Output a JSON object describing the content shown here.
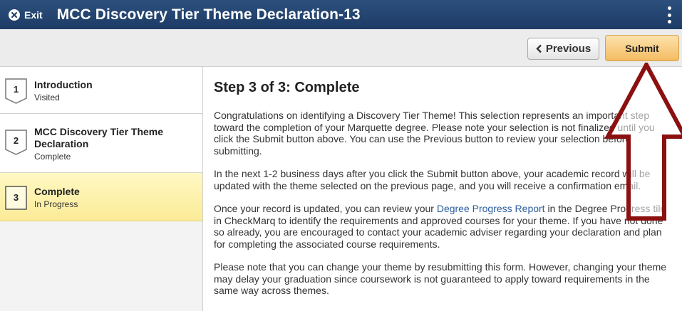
{
  "header": {
    "exit_label": "Exit",
    "title": "MCC Discovery Tier Theme Declaration-13"
  },
  "toolbar": {
    "previous_label": "Previous",
    "submit_label": "Submit"
  },
  "steps": [
    {
      "number": "1",
      "name": "Introduction",
      "status": "Visited"
    },
    {
      "number": "2",
      "name": "MCC Discovery Tier Theme Declaration",
      "status": "Complete"
    },
    {
      "number": "3",
      "name": "Complete",
      "status": "In Progress"
    }
  ],
  "main": {
    "step_title": "Step 3 of 3: Complete",
    "para1": "Congratulations on identifying a Discovery Tier Theme! This selection represents an important step toward the completion of your Marquette degree. Please note your selection is not finalized until you click the Submit button above. You can use the Previous button to review your selection before submitting.",
    "para2": "In the next 1-2 business days after you click the Submit button above, your academic record will be updated with the theme selected on the previous page, and you will receive a confirmation email.",
    "para3_before": "Once your record is updated, you can review your ",
    "para3_link": "Degree Progress Report",
    "para3_after": " in the Degree Progress tile in CheckMarq to identify the requirements and approved courses for your theme. If you have not done so already, you are encouraged to contact your academic adviser regarding your declaration and plan for completing the associated course requirements.",
    "para4": "Please note that you can change your theme by resubmitting this form. However, changing your theme may delay your graduation since coursework is not guaranteed to apply toward requirements in the same way across themes."
  },
  "colors": {
    "header": "#1d3c66",
    "submit": "#f4bc62",
    "active_step": "#fbeb97",
    "link": "#2a5d9f",
    "arrow": "#8b1010"
  }
}
